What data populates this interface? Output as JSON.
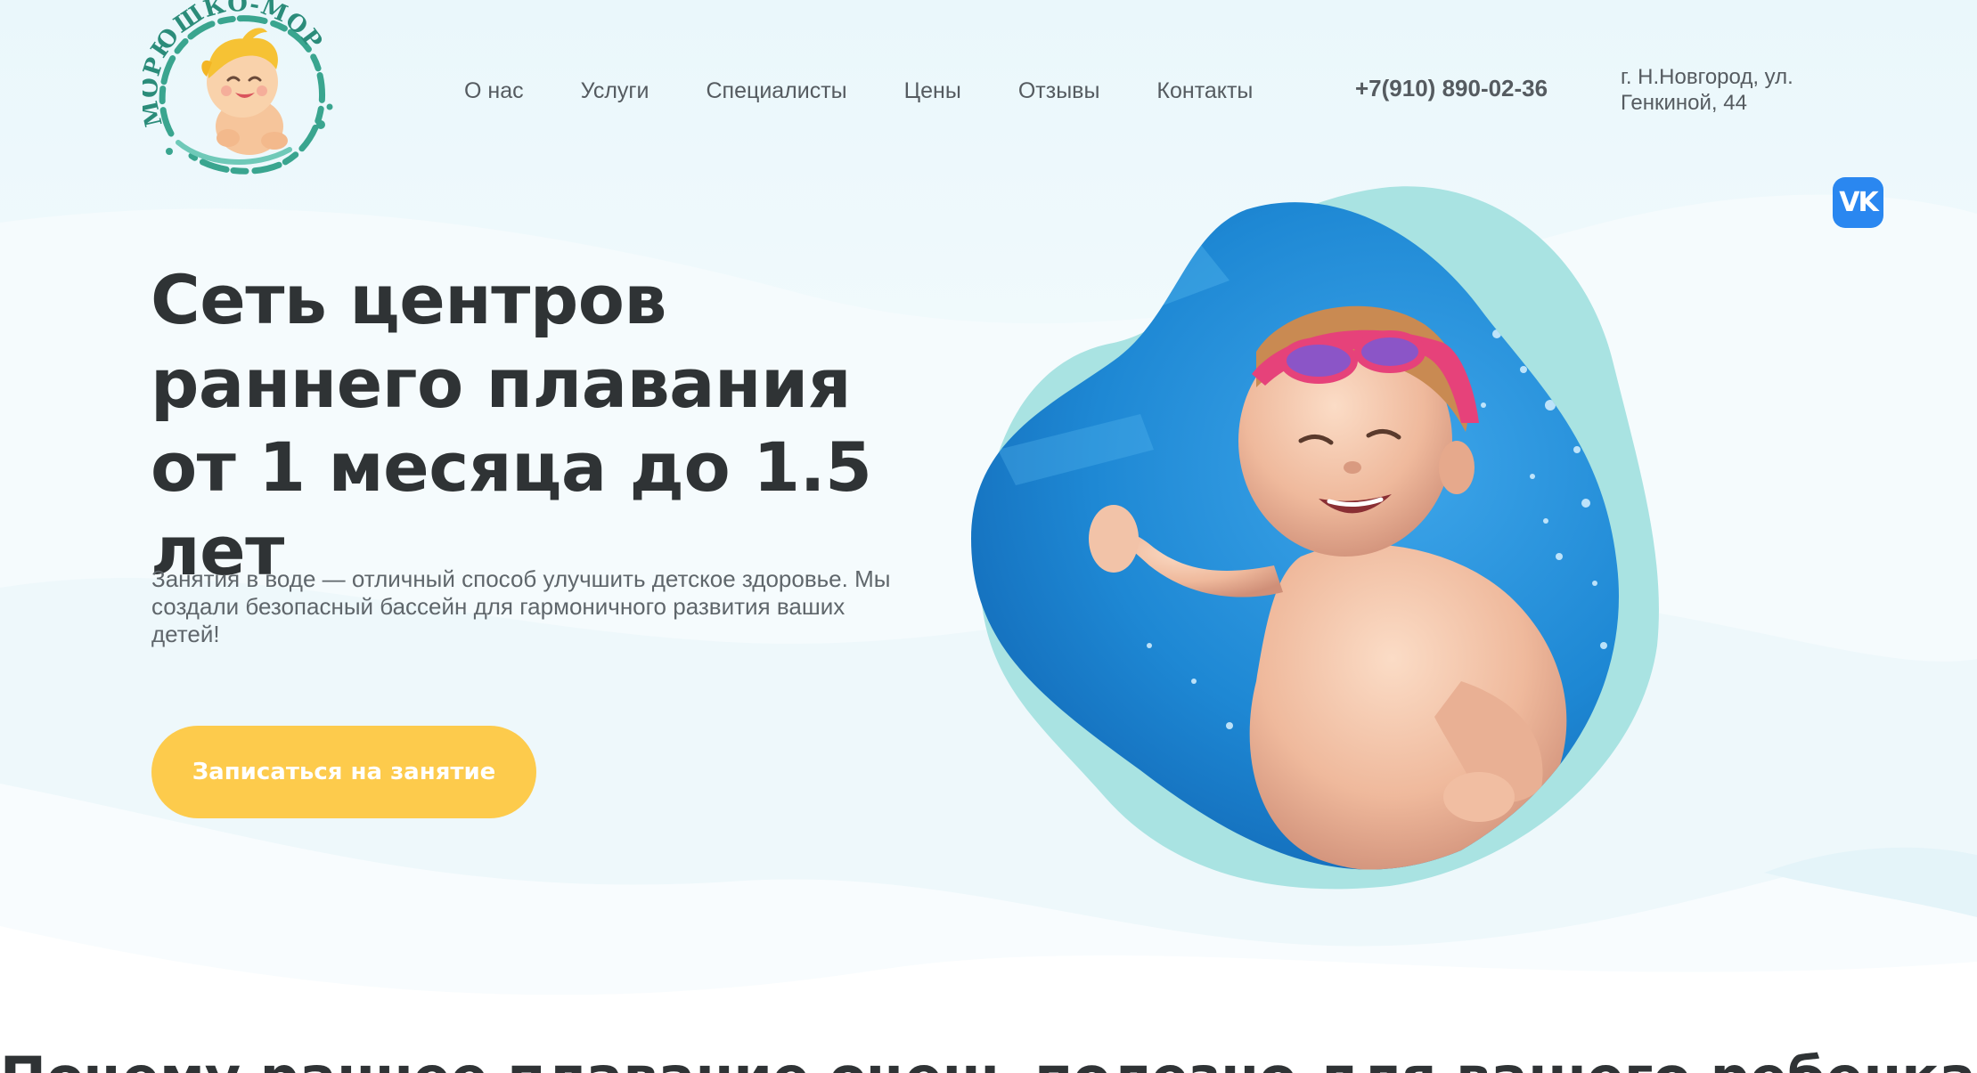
{
  "brand": {
    "logo_text": "МОРЮШКО-МОРЕ"
  },
  "nav": {
    "items": [
      {
        "label": "О нас"
      },
      {
        "label": "Услуги"
      },
      {
        "label": "Специалисты"
      },
      {
        "label": "Цены"
      },
      {
        "label": "Отзывы"
      },
      {
        "label": "Контакты"
      }
    ]
  },
  "contacts": {
    "phone": "+7(910) 890-02-36",
    "address": "г. Н.Новгород, ул. Генкиной, 44"
  },
  "social": {
    "vk_icon": "vk-icon",
    "vk_glyph": "VK"
  },
  "hero": {
    "title": "Сеть центров раннего плавания от 1 месяца до 1.5 лет",
    "subtitle": "Занятия в воде — отличный способ улучшить детское здоровье. Мы создали безопасный бассейн для гармоничного развития ваших детей!",
    "cta_label": "Записаться на занятие",
    "image": "underwater-baby-photo"
  },
  "next_section": {
    "heading": "Почему раннее плавание очень полезно для вашего ребенка?"
  },
  "colors": {
    "accent_yellow": "#fdcb4c",
    "text_dark": "#2f3335",
    "text_muted": "#5f666b",
    "vk_blue": "#2a87f0",
    "teal_blob": "#a9e3e2",
    "water_blue": "#1f86d3",
    "background": "#eaf7fb"
  }
}
